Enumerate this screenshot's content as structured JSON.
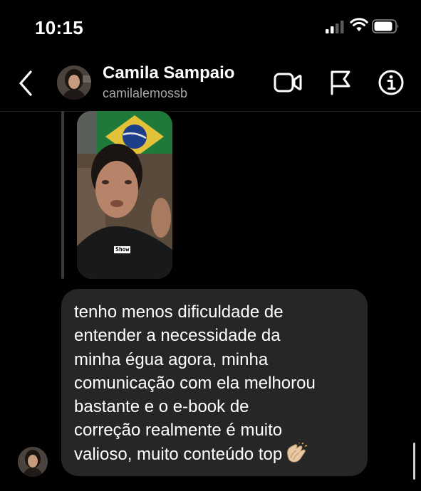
{
  "status_bar": {
    "time": "10:15",
    "icons": [
      "signal-icon",
      "wifi-icon",
      "battery-icon"
    ]
  },
  "header": {
    "name": "Camila Sampaio",
    "username": "camilalemossb",
    "icons": [
      "back-icon",
      "avatar",
      "video-call-icon",
      "flag-icon",
      "info-icon"
    ]
  },
  "reply": {
    "video_caption": "Show"
  },
  "message": {
    "text": "tenho menos dificuldade de\nentender a necessidade da\nminha égua agora, minha\ncomunicação com ela melhorou\nbastante e o e-book de\ncorreção realmente é muito\nvalioso, muito conteúdo top",
    "emoji_icon": "clapping-hands-icon"
  },
  "colors": {
    "background": "#000000",
    "bubble": "#262626",
    "secondary_text": "#a8a8a8"
  }
}
